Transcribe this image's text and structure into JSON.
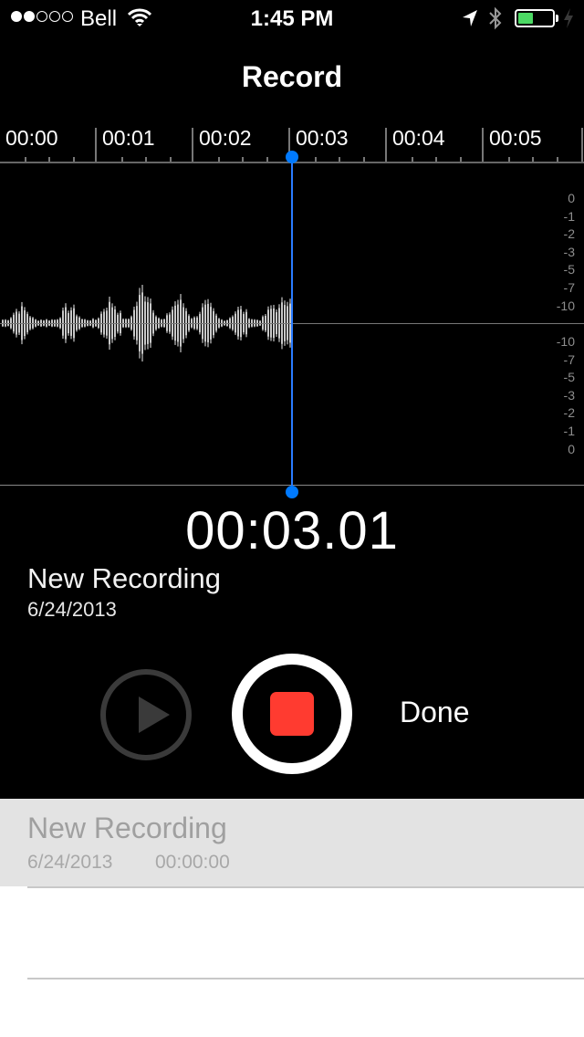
{
  "status_bar": {
    "signal_strength": {
      "filled": 2,
      "total": 5
    },
    "carrier": "Bell",
    "time": "1:45 PM",
    "battery_level_percent": 45,
    "icons": [
      "wifi-icon",
      "location-arrow-icon",
      "bluetooth-icon",
      "battery-icon",
      "charging-bolt-icon"
    ],
    "battery_color": "#4cd964"
  },
  "header": {
    "title": "Record"
  },
  "timeline": {
    "labels": [
      "00:00",
      "00:01",
      "00:02",
      "00:03",
      "00:04",
      "00:05"
    ]
  },
  "level_meter": {
    "upper_labels": [
      "0",
      "-1",
      "-2",
      "-3",
      "-5",
      "-7",
      "-10"
    ],
    "lower_labels": [
      "-10",
      "-7",
      "-5",
      "-3",
      "-2",
      "-1",
      "0"
    ]
  },
  "playhead": {
    "position_seconds": 3.01,
    "color": "#007aff"
  },
  "recording": {
    "elapsed": "00:03.01",
    "name": "New Recording",
    "date": "6/24/2013"
  },
  "controls": {
    "play_label": "Play",
    "record_label": "Stop",
    "done_label": "Done",
    "stop_color": "#ff3b30"
  },
  "list": {
    "items": [
      {
        "name": "New Recording",
        "date": "6/24/2013",
        "duration": "00:00:00",
        "selected": true
      }
    ]
  }
}
